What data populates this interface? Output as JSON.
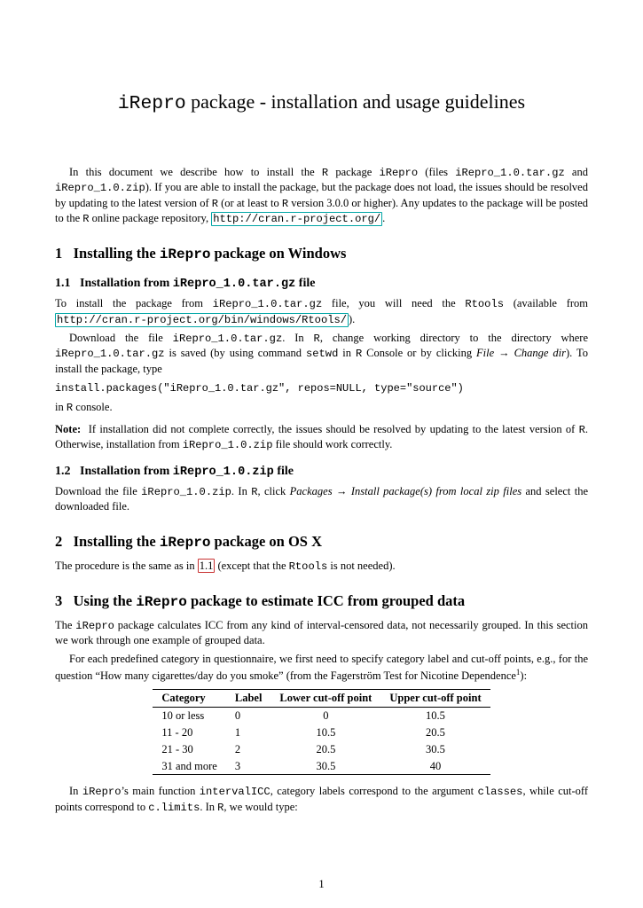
{
  "title": {
    "code": "iRepro",
    "rest": " package - installation and usage guidelines"
  },
  "intro": {
    "p1a": "In this document we describe how to install the ",
    "R": "R",
    "p1b": " package ",
    "pkg": "iRepro",
    "p1c": " (files ",
    "f1": "iRepro_1.0.tar.gz",
    "p1d": " and ",
    "f2": "iRepro_1.0.zip",
    "p1e": "). If you are able to install the package, but the package does not load, the issues should be resolved by updating to the latest version of ",
    "p1f": " (or at least to ",
    "p1g": " version 3.0.0 or higher). Any updates to the package will be posted to the ",
    "p1h": " online package repository, ",
    "url": "http://cran.r-project.org/",
    "p1i": "."
  },
  "s1": {
    "num": "1",
    "a": "Installing the ",
    "code": "iRepro",
    "b": " package on Windows"
  },
  "s11": {
    "num": "1.1",
    "a": "Installation from ",
    "code": "iRepro_1.0.tar.gz",
    "b": " file",
    "p1a": "To install the package from ",
    "p1b": " file, you will need the ",
    "rtools": "Rtools",
    "p1c": " (available from ",
    "url": "http://cran.r-project.org/bin/windows/Rtools/",
    "p1d": ").",
    "p2a": "Download the file ",
    "p2b": ". In ",
    "R": "R",
    "p2c": ", change working directory to the directory where ",
    "p2d": " is saved (by using command ",
    "setwd": "setwd",
    "p2e": " in ",
    "p2f": " Console or by clicking ",
    "menu1": "File",
    "menu2": "Change dir",
    "p2g": "). To install the package, type",
    "cmd": "install.packages(\"iRepro_1.0.tar.gz\", repos=NULL, type=\"source\")",
    "p3a": "in ",
    "p3b": " console.",
    "note_lbl": "Note:",
    "note_a": "If installation did not complete correctly, the issues should be resolved by updating to the latest version of ",
    "note_b": ". Otherwise, installation from ",
    "note_file": "iRepro_1.0.zip",
    "note_c": " file should work correctly."
  },
  "s12": {
    "num": "1.2",
    "a": "Installation from ",
    "code": "iRepro_1.0.zip",
    "b": " file",
    "p1a": "Download the file ",
    "p1b": ". In ",
    "R": "R",
    "p1c": ", click ",
    "menu1": "Packages",
    "menu2": "Install package(s) from local zip files",
    "p1d": " and select the downloaded file."
  },
  "s2": {
    "num": "2",
    "a": "Installing the ",
    "code": "iRepro",
    "b": " package on OS X",
    "p1a": "The procedure is the same as in ",
    "ref": "1.1",
    "p1b": " (except that the ",
    "rtools": "Rtools",
    "p1c": " is not needed)."
  },
  "s3": {
    "num": "3",
    "a": "Using the ",
    "code": "iRepro",
    "b": " package to estimate ICC from grouped data",
    "p1a": "The ",
    "p1b": " package calculates ICC from any kind of interval-censored data, not necessarily grouped. In this section we work through one example of grouped data.",
    "p2a": "For each predefined category in questionnaire, we first need to specify category label and cut-off points, e.g., for the question “How many cigarettes/day do you smoke” (from the Fagerström Test for Nicotine Dependence",
    "p2b": "):",
    "p3a": "In ",
    "p3b": "’s main function ",
    "fn": "intervalICC",
    "p3c": ", category labels correspond to the argument ",
    "arg1": "classes",
    "p3d": ", while cut-off points correspond to ",
    "arg2": "c.limits",
    "p3e": ". In ",
    "R": "R",
    "p3f": ", we would type:"
  },
  "table": {
    "h1": "Category",
    "h2": "Label",
    "h3": "Lower cut-off point",
    "h4": "Upper cut-off point",
    "rows": [
      {
        "cat": "10 or less",
        "label": "0",
        "low": "0",
        "up": "10.5"
      },
      {
        "cat": "11 - 20",
        "label": "1",
        "low": "10.5",
        "up": "20.5"
      },
      {
        "cat": "21 - 30",
        "label": "2",
        "low": "20.5",
        "up": "30.5"
      },
      {
        "cat": "31 and more",
        "label": "3",
        "low": "30.5",
        "up": "40"
      }
    ]
  },
  "pagenum": "1"
}
